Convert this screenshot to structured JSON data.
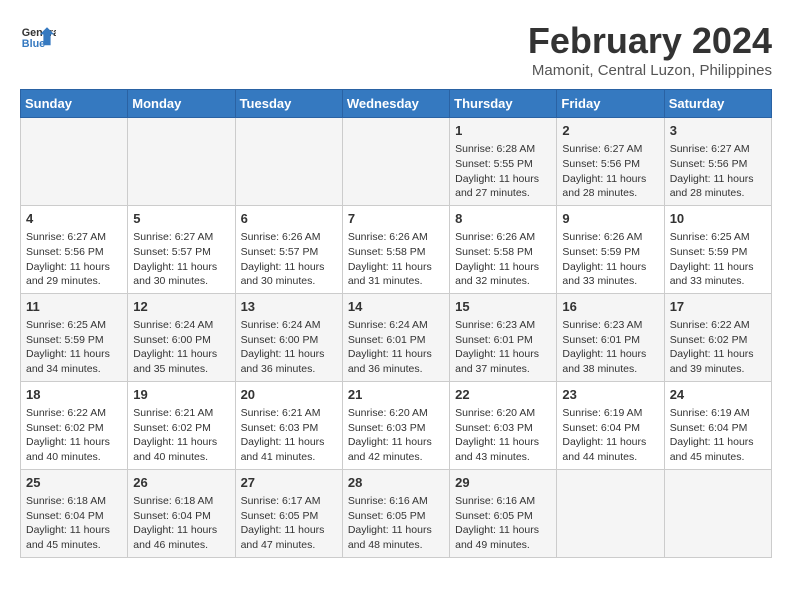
{
  "header": {
    "logo_line1": "General",
    "logo_line2": "Blue",
    "month": "February 2024",
    "location": "Mamonit, Central Luzon, Philippines"
  },
  "weekdays": [
    "Sunday",
    "Monday",
    "Tuesday",
    "Wednesday",
    "Thursday",
    "Friday",
    "Saturday"
  ],
  "weeks": [
    [
      {
        "day": "",
        "info": ""
      },
      {
        "day": "",
        "info": ""
      },
      {
        "day": "",
        "info": ""
      },
      {
        "day": "",
        "info": ""
      },
      {
        "day": "1",
        "info": "Sunrise: 6:28 AM\nSunset: 5:55 PM\nDaylight: 11 hours and 27 minutes."
      },
      {
        "day": "2",
        "info": "Sunrise: 6:27 AM\nSunset: 5:56 PM\nDaylight: 11 hours and 28 minutes."
      },
      {
        "day": "3",
        "info": "Sunrise: 6:27 AM\nSunset: 5:56 PM\nDaylight: 11 hours and 28 minutes."
      }
    ],
    [
      {
        "day": "4",
        "info": "Sunrise: 6:27 AM\nSunset: 5:56 PM\nDaylight: 11 hours and 29 minutes."
      },
      {
        "day": "5",
        "info": "Sunrise: 6:27 AM\nSunset: 5:57 PM\nDaylight: 11 hours and 30 minutes."
      },
      {
        "day": "6",
        "info": "Sunrise: 6:26 AM\nSunset: 5:57 PM\nDaylight: 11 hours and 30 minutes."
      },
      {
        "day": "7",
        "info": "Sunrise: 6:26 AM\nSunset: 5:58 PM\nDaylight: 11 hours and 31 minutes."
      },
      {
        "day": "8",
        "info": "Sunrise: 6:26 AM\nSunset: 5:58 PM\nDaylight: 11 hours and 32 minutes."
      },
      {
        "day": "9",
        "info": "Sunrise: 6:26 AM\nSunset: 5:59 PM\nDaylight: 11 hours and 33 minutes."
      },
      {
        "day": "10",
        "info": "Sunrise: 6:25 AM\nSunset: 5:59 PM\nDaylight: 11 hours and 33 minutes."
      }
    ],
    [
      {
        "day": "11",
        "info": "Sunrise: 6:25 AM\nSunset: 5:59 PM\nDaylight: 11 hours and 34 minutes."
      },
      {
        "day": "12",
        "info": "Sunrise: 6:24 AM\nSunset: 6:00 PM\nDaylight: 11 hours and 35 minutes."
      },
      {
        "day": "13",
        "info": "Sunrise: 6:24 AM\nSunset: 6:00 PM\nDaylight: 11 hours and 36 minutes."
      },
      {
        "day": "14",
        "info": "Sunrise: 6:24 AM\nSunset: 6:01 PM\nDaylight: 11 hours and 36 minutes."
      },
      {
        "day": "15",
        "info": "Sunrise: 6:23 AM\nSunset: 6:01 PM\nDaylight: 11 hours and 37 minutes."
      },
      {
        "day": "16",
        "info": "Sunrise: 6:23 AM\nSunset: 6:01 PM\nDaylight: 11 hours and 38 minutes."
      },
      {
        "day": "17",
        "info": "Sunrise: 6:22 AM\nSunset: 6:02 PM\nDaylight: 11 hours and 39 minutes."
      }
    ],
    [
      {
        "day": "18",
        "info": "Sunrise: 6:22 AM\nSunset: 6:02 PM\nDaylight: 11 hours and 40 minutes."
      },
      {
        "day": "19",
        "info": "Sunrise: 6:21 AM\nSunset: 6:02 PM\nDaylight: 11 hours and 40 minutes."
      },
      {
        "day": "20",
        "info": "Sunrise: 6:21 AM\nSunset: 6:03 PM\nDaylight: 11 hours and 41 minutes."
      },
      {
        "day": "21",
        "info": "Sunrise: 6:20 AM\nSunset: 6:03 PM\nDaylight: 11 hours and 42 minutes."
      },
      {
        "day": "22",
        "info": "Sunrise: 6:20 AM\nSunset: 6:03 PM\nDaylight: 11 hours and 43 minutes."
      },
      {
        "day": "23",
        "info": "Sunrise: 6:19 AM\nSunset: 6:04 PM\nDaylight: 11 hours and 44 minutes."
      },
      {
        "day": "24",
        "info": "Sunrise: 6:19 AM\nSunset: 6:04 PM\nDaylight: 11 hours and 45 minutes."
      }
    ],
    [
      {
        "day": "25",
        "info": "Sunrise: 6:18 AM\nSunset: 6:04 PM\nDaylight: 11 hours and 45 minutes."
      },
      {
        "day": "26",
        "info": "Sunrise: 6:18 AM\nSunset: 6:04 PM\nDaylight: 11 hours and 46 minutes."
      },
      {
        "day": "27",
        "info": "Sunrise: 6:17 AM\nSunset: 6:05 PM\nDaylight: 11 hours and 47 minutes."
      },
      {
        "day": "28",
        "info": "Sunrise: 6:16 AM\nSunset: 6:05 PM\nDaylight: 11 hours and 48 minutes."
      },
      {
        "day": "29",
        "info": "Sunrise: 6:16 AM\nSunset: 6:05 PM\nDaylight: 11 hours and 49 minutes."
      },
      {
        "day": "",
        "info": ""
      },
      {
        "day": "",
        "info": ""
      }
    ]
  ]
}
